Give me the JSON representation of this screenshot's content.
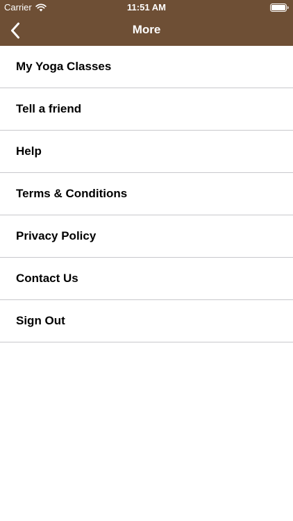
{
  "status_bar": {
    "carrier": "Carrier",
    "time": "11:51 AM",
    "icons": [
      "wifi-icon",
      "battery-icon"
    ]
  },
  "nav_bar": {
    "title": "More",
    "back_icon": "chevron-left-icon"
  },
  "colors": {
    "header_bg": "#6e4f35",
    "header_text": "#ffffff",
    "divider": "#c8c8cc",
    "item_text": "#000000"
  },
  "menu": {
    "items": [
      {
        "label": "My Yoga Classes"
      },
      {
        "label": "Tell a friend"
      },
      {
        "label": "Help"
      },
      {
        "label": "Terms & Conditions"
      },
      {
        "label": "Privacy Policy"
      },
      {
        "label": "Contact Us"
      },
      {
        "label": "Sign Out"
      }
    ]
  }
}
